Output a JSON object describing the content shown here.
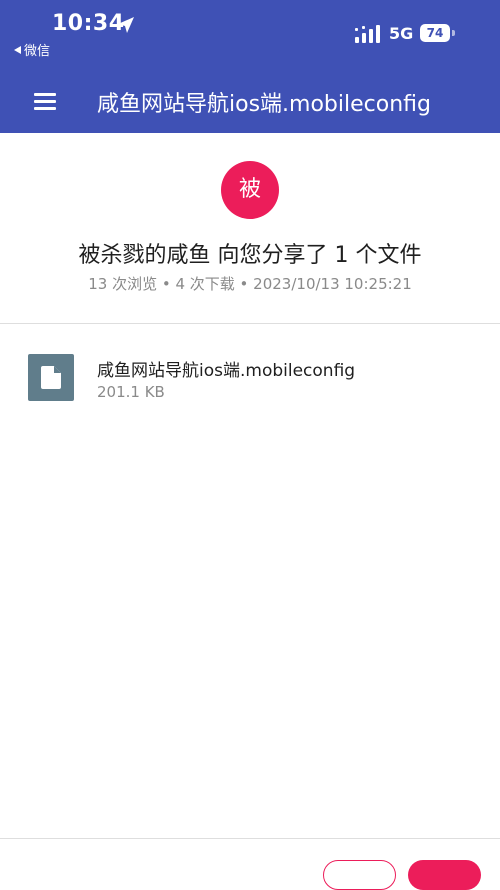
{
  "status_bar": {
    "time": "10:34",
    "back_app": "微信",
    "network": "5G",
    "battery": "74"
  },
  "app_bar": {
    "title": "咸鱼网站导航ios端.mobileconfig"
  },
  "share": {
    "avatar_letter": "被",
    "heading": "被杀戮的咸鱼 向您分享了 1 个文件",
    "meta": "13 次浏览 • 4 次下载 • 2023/10/13 10:25:21"
  },
  "files": [
    {
      "name": "咸鱼网站导航ios端.mobileconfig",
      "size": "201.1 KB",
      "icon": "document-icon"
    }
  ],
  "colors": {
    "app_bar": "#3f51b5",
    "accent": "#ec1d5a",
    "file_icon_bg": "#607d8b"
  }
}
